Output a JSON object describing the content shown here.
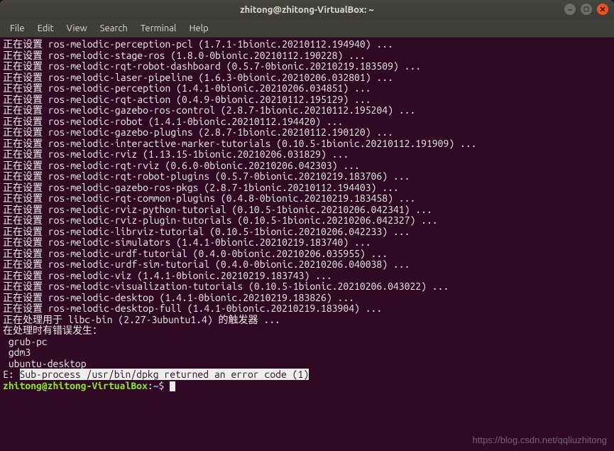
{
  "window": {
    "title": "zhitong@zhitong-VirtualBox: ~"
  },
  "menubar": {
    "items": [
      "File",
      "Edit",
      "View",
      "Search",
      "Terminal",
      "Help"
    ]
  },
  "terminal": {
    "setup_prefix": "正在设置 ",
    "lines": [
      "ros-melodic-perception-pcl (1.7.1-1bionic.20210112.194940) ...",
      "ros-melodic-stage-ros (1.8.0-0bionic.20210112.190228) ...",
      "ros-melodic-rqt-robot-dashboard (0.5.7-0bionic.20210219.183509) ...",
      "ros-melodic-laser-pipeline (1.6.3-0bionic.20210206.032801) ...",
      "ros-melodic-perception (1.4.1-0bionic.20210206.034851) ...",
      "ros-melodic-rqt-action (0.4.9-0bionic.20210112.195129) ...",
      "ros-melodic-gazebo-ros-control (2.8.7-1bionic.20210112.195204) ...",
      "ros-melodic-robot (1.4.1-0bionic.20210112.194420) ...",
      "ros-melodic-gazebo-plugins (2.8.7-1bionic.20210112.190120) ...",
      "ros-melodic-interactive-marker-tutorials (0.10.5-1bionic.20210112.191909) ...",
      "ros-melodic-rviz (1.13.15-1bionic.20210206.031829) ...",
      "ros-melodic-rqt-rviz (0.6.0-0bionic.20210206.042303) ...",
      "ros-melodic-rqt-robot-plugins (0.5.7-0bionic.20210219.183706) ...",
      "ros-melodic-gazebo-ros-pkgs (2.8.7-1bionic.20210112.194403) ...",
      "ros-melodic-rqt-common-plugins (0.4.8-0bionic.20210219.183458) ...",
      "ros-melodic-rviz-python-tutorial (0.10.5-1bionic.20210206.042341) ...",
      "ros-melodic-rviz-plugin-tutorials (0.10.5-1bionic.20210206.042327) ...",
      "ros-melodic-librviz-tutorial (0.10.5-1bionic.20210206.042233) ...",
      "ros-melodic-simulators (1.4.1-0bionic.20210219.183740) ...",
      "ros-melodic-urdf-tutorial (0.4.0-0bionic.20210206.035955) ...",
      "ros-melodic-urdf-sim-tutorial (0.4.0-0bionic.20210206.040038) ...",
      "ros-melodic-viz (1.4.1-0bionic.20210219.183743) ...",
      "ros-melodic-visualization-tutorials (0.10.5-1bionic.20210206.043022) ...",
      "ros-melodic-desktop (1.4.1-0bionic.20210219.183826) ...",
      "ros-melodic-desktop-full (1.4.1-0bionic.20210219.183904) ..."
    ],
    "processing": "正在处理用于 libc-bin (2.27-3ubuntu1.4) 的触发器 ...",
    "error_intro": "在处理时有错误发生：",
    "error_items": [
      " grub-pc",
      " gdm3",
      " ubuntu-desktop"
    ],
    "error_line_prefix": "E: ",
    "error_line_body": "Sub-process /usr/bin/dpkg returned an error code (1)",
    "prompt": {
      "userhost": "zhitong@zhitong-VirtualBox",
      "sep": ":",
      "path": "~",
      "dollar": "$ "
    }
  },
  "watermark": "https://blog.csdn.net/qqliuzhitong"
}
